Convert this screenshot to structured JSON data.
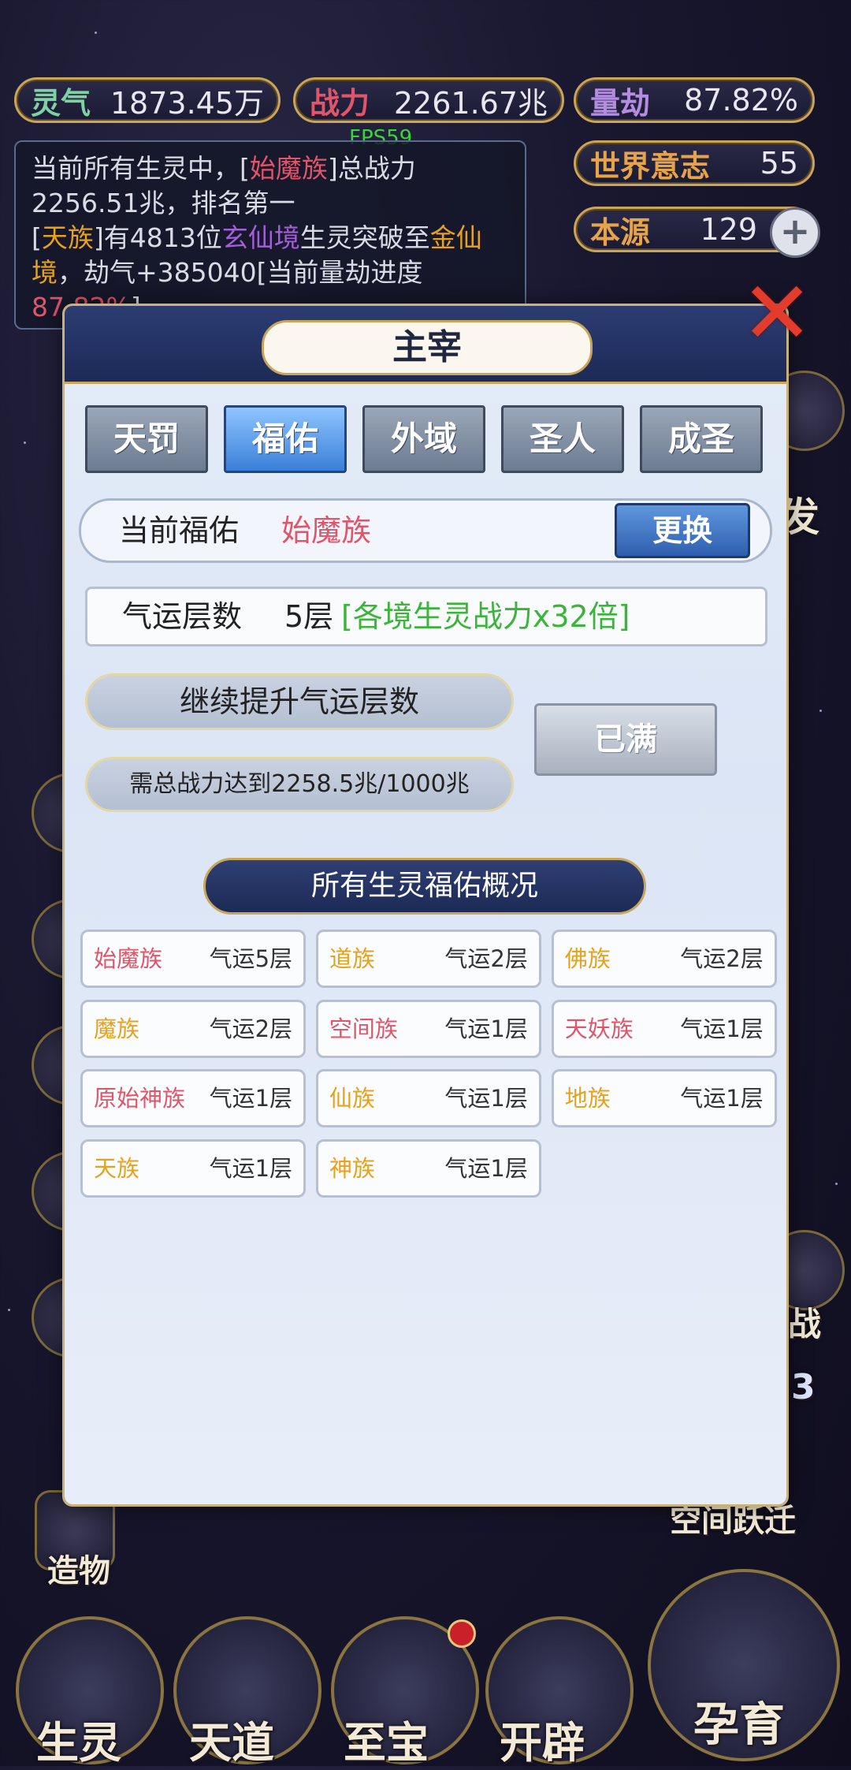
{
  "stats": {
    "lingqi": {
      "label": "灵气",
      "value": "1873.45万"
    },
    "zhanli": {
      "label": "战力",
      "value": "2261.67兆"
    },
    "liangjie": {
      "label": "量劫",
      "value": "87.82%"
    },
    "shijie": {
      "label": "世界意志",
      "value": "55"
    },
    "benyuan": {
      "label": "本源",
      "value": "129"
    }
  },
  "fps": "FPS59",
  "message": {
    "line1_pre": "当前所有生灵中，[",
    "line1_race": "始魔族",
    "line1_post": "]总战力2256.51兆，排名第一",
    "line2_open": "[",
    "line2_race": "天族",
    "line2_mid1": "]有4813位",
    "line2_realm1": "玄仙境",
    "line2_mid2": "生灵突破至",
    "line2_realm2": "金仙境",
    "line2_mid3": "，劫气+385040[当前量劫进度",
    "line2_progress": "87.82%",
    "line2_end": "]"
  },
  "side_labels": {
    "right_fa": "发",
    "right_zhan": "战",
    "right_3": "3",
    "right_kongjian": "空间跃迁",
    "left_zaowu": "造物"
  },
  "bottom_nav": [
    "生灵",
    "天道",
    "至宝",
    "开辟",
    "孕育"
  ],
  "modal": {
    "title": "主宰",
    "close_symbol": "✕",
    "tabs": [
      "天罚",
      "福佑",
      "外域",
      "圣人",
      "成圣"
    ],
    "active_tab": 1,
    "current": {
      "label": "当前福佑",
      "value": "始魔族",
      "button": "更换"
    },
    "level": {
      "label": "气运层数",
      "value": "5层",
      "bonus": "[各境生灵战力x32倍]"
    },
    "upgrade": {
      "title": "继续提升气运层数",
      "requirement": "需总战力达到2258.5兆/1000兆",
      "button": "已满"
    },
    "section_title": "所有生灵福佑概况",
    "races": [
      {
        "name": "始魔族",
        "level": "气运5层",
        "color": "#e0556a"
      },
      {
        "name": "道族",
        "level": "气运2层",
        "color": "#e8a11c"
      },
      {
        "name": "佛族",
        "level": "气运2层",
        "color": "#e8a11c"
      },
      {
        "name": "魔族",
        "level": "气运2层",
        "color": "#e8a11c"
      },
      {
        "name": "空间族",
        "level": "气运1层",
        "color": "#e0556a"
      },
      {
        "name": "天妖族",
        "level": "气运1层",
        "color": "#e0556a"
      },
      {
        "name": "原始神族",
        "level": "气运1层",
        "color": "#e0556a"
      },
      {
        "name": "仙族",
        "level": "气运1层",
        "color": "#e8a11c"
      },
      {
        "name": "地族",
        "level": "气运1层",
        "color": "#e8a11c"
      },
      {
        "name": "天族",
        "level": "气运1层",
        "color": "#e8a11c"
      },
      {
        "name": "神族",
        "level": "气运1层",
        "color": "#e8a11c"
      }
    ]
  },
  "colors": {
    "accent_gold": "#c9a45b",
    "red_text": "#e0556a",
    "orange_text": "#e8a11c",
    "green_text": "#3ab53a"
  }
}
